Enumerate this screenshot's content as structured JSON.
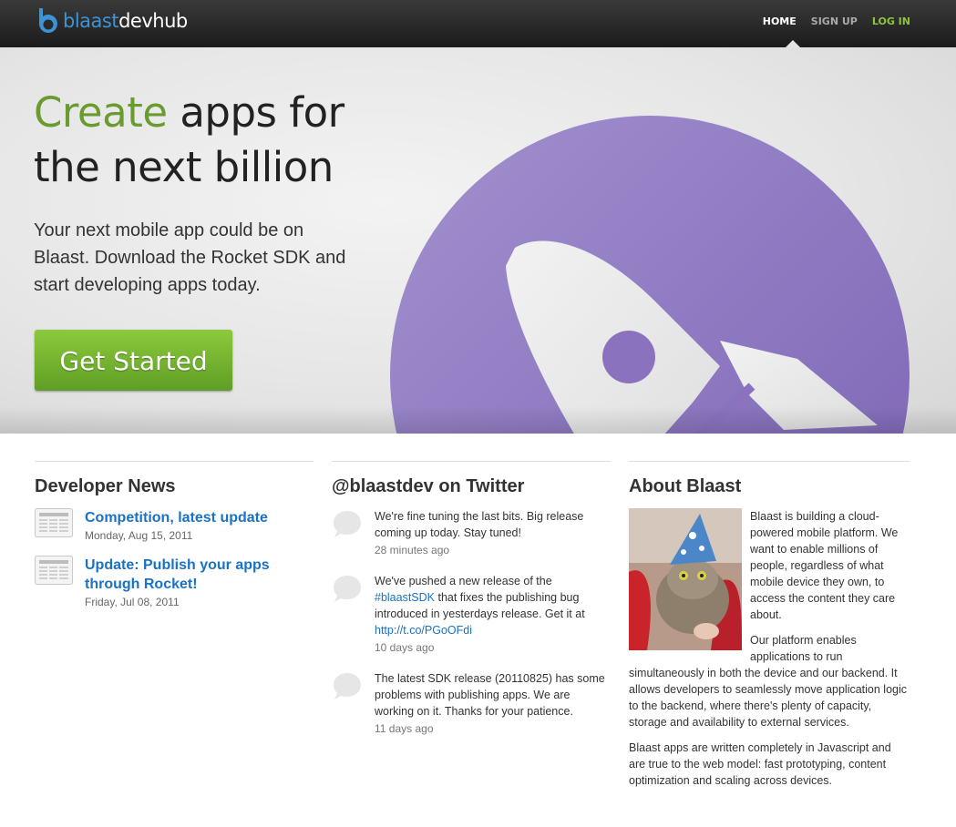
{
  "header": {
    "logo_part1": "blaast",
    "logo_part2": "devhub",
    "nav": [
      "HOME",
      "SIGN UP",
      "LOG IN"
    ]
  },
  "hero": {
    "title_highlight": "Create",
    "title_rest": " apps for the next billion",
    "subtitle": "Your next mobile app could be on Blaast. Download the Rocket SDK and start developing apps today.",
    "cta": "Get Started"
  },
  "news": {
    "heading": "Developer News",
    "items": [
      {
        "title": "Competition, latest update",
        "date": "Monday, Aug 15, 2011"
      },
      {
        "title": "Update: Publish your apps through Rocket!",
        "date": "Friday, Jul 08, 2011"
      }
    ]
  },
  "twitter": {
    "heading": "@blaastdev on Twitter",
    "tweets": [
      {
        "text": "We're fine tuning the last bits. Big release coming up today. Stay tuned!",
        "time": "28 minutes ago"
      },
      {
        "pre": "We've pushed a new release of the ",
        "hashtag": "#blaastSDK",
        "mid": " that fixes the publishing bug introduced in yesterdays release. Get it at ",
        "link": "http://t.co/PGoOFdi",
        "time": "10 days ago"
      },
      {
        "text": "The latest SDK release (20110825) has some problems with publishing apps. We are working on it. Thanks for your patience.",
        "time": "11 days ago"
      }
    ]
  },
  "about": {
    "heading": "About Blaast",
    "paragraphs": [
      "Blaast is building a cloud-powered mobile platform. We want to enable millions of people, regardless of what mobile device they own, to access the content they care about.",
      "Our platform enables applications to run simultaneously in both the device and our backend. It allows developers to seamlessly move application logic to the backend, where there's plenty of capacity, storage and availability to external services.",
      "Blaast apps are written completely in Javascript and are true to the web model: fast prototyping, content optimization and scaling across devices."
    ]
  },
  "colors": {
    "brand_blue": "#3d93d4",
    "accent_green": "#6a9b2f",
    "link_blue": "#1a72c4",
    "rocket_purple": "#8a72bf"
  }
}
